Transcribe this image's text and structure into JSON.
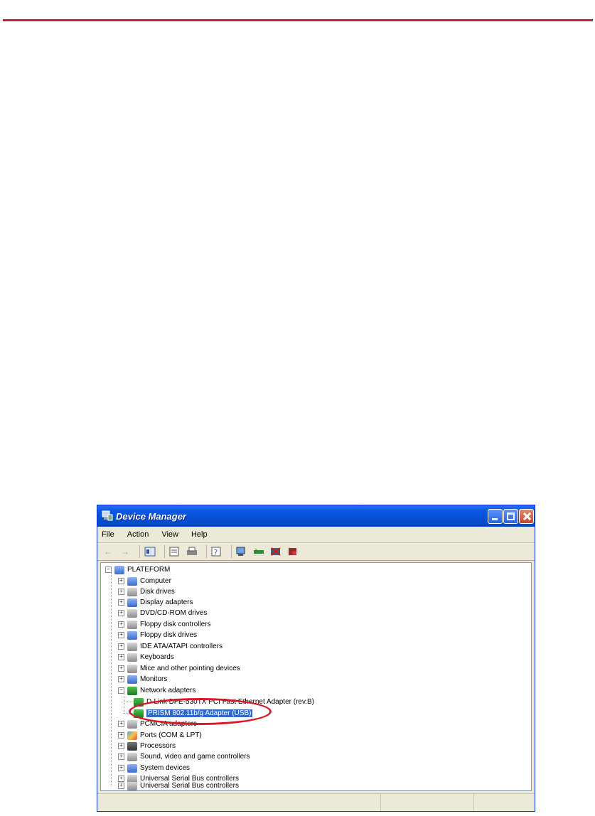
{
  "window": {
    "title": "Device Manager",
    "menu": [
      "File",
      "Action",
      "View",
      "Help"
    ]
  },
  "tree": {
    "root": "PLATEFORM",
    "items": [
      {
        "label": "Computer",
        "icon": "computer-icon",
        "expanded": false
      },
      {
        "label": "Disk drives",
        "icon": "disk-drive-icon",
        "expanded": false
      },
      {
        "label": "Display adapters",
        "icon": "display-adapter-icon",
        "expanded": false
      },
      {
        "label": "DVD/CD-ROM drives",
        "icon": "cdrom-icon",
        "expanded": false
      },
      {
        "label": "Floppy disk controllers",
        "icon": "floppy-controller-icon",
        "expanded": false
      },
      {
        "label": "Floppy disk drives",
        "icon": "floppy-drive-icon",
        "expanded": false
      },
      {
        "label": "IDE ATA/ATAPI controllers",
        "icon": "ide-controller-icon",
        "expanded": false
      },
      {
        "label": "Keyboards",
        "icon": "keyboard-icon",
        "expanded": false
      },
      {
        "label": "Mice and other pointing devices",
        "icon": "mouse-icon",
        "expanded": false
      },
      {
        "label": "Monitors",
        "icon": "monitor-icon",
        "expanded": false
      },
      {
        "label": "Network adapters",
        "icon": "network-adapter-icon",
        "expanded": true
      },
      {
        "label": "D-Link DFE-530TX PCI Fast Ethernet Adapter (rev.B)",
        "icon": "network-card-icon",
        "child": true
      },
      {
        "label": "PRISM 802.11b/g Adapter (USB)",
        "icon": "network-card-icon",
        "child": true,
        "selected": true
      },
      {
        "label": "PCMCIA adapters",
        "icon": "pcmcia-icon",
        "expanded": false
      },
      {
        "label": "Ports (COM & LPT)",
        "icon": "port-icon",
        "expanded": false
      },
      {
        "label": "Processors",
        "icon": "processor-icon",
        "expanded": false
      },
      {
        "label": "Sound, video and game controllers",
        "icon": "sound-icon",
        "expanded": false
      },
      {
        "label": "System devices",
        "icon": "system-device-icon",
        "expanded": false
      },
      {
        "label": "Universal Serial Bus controllers",
        "icon": "usb-icon",
        "expanded": false
      },
      {
        "label": "Universal Serial Bus controllers",
        "icon": "usb-icon",
        "expanded": false
      }
    ]
  },
  "colors": {
    "rule": "#c0202a",
    "highlight": "#d41a2a",
    "selection": "#316ac5"
  }
}
